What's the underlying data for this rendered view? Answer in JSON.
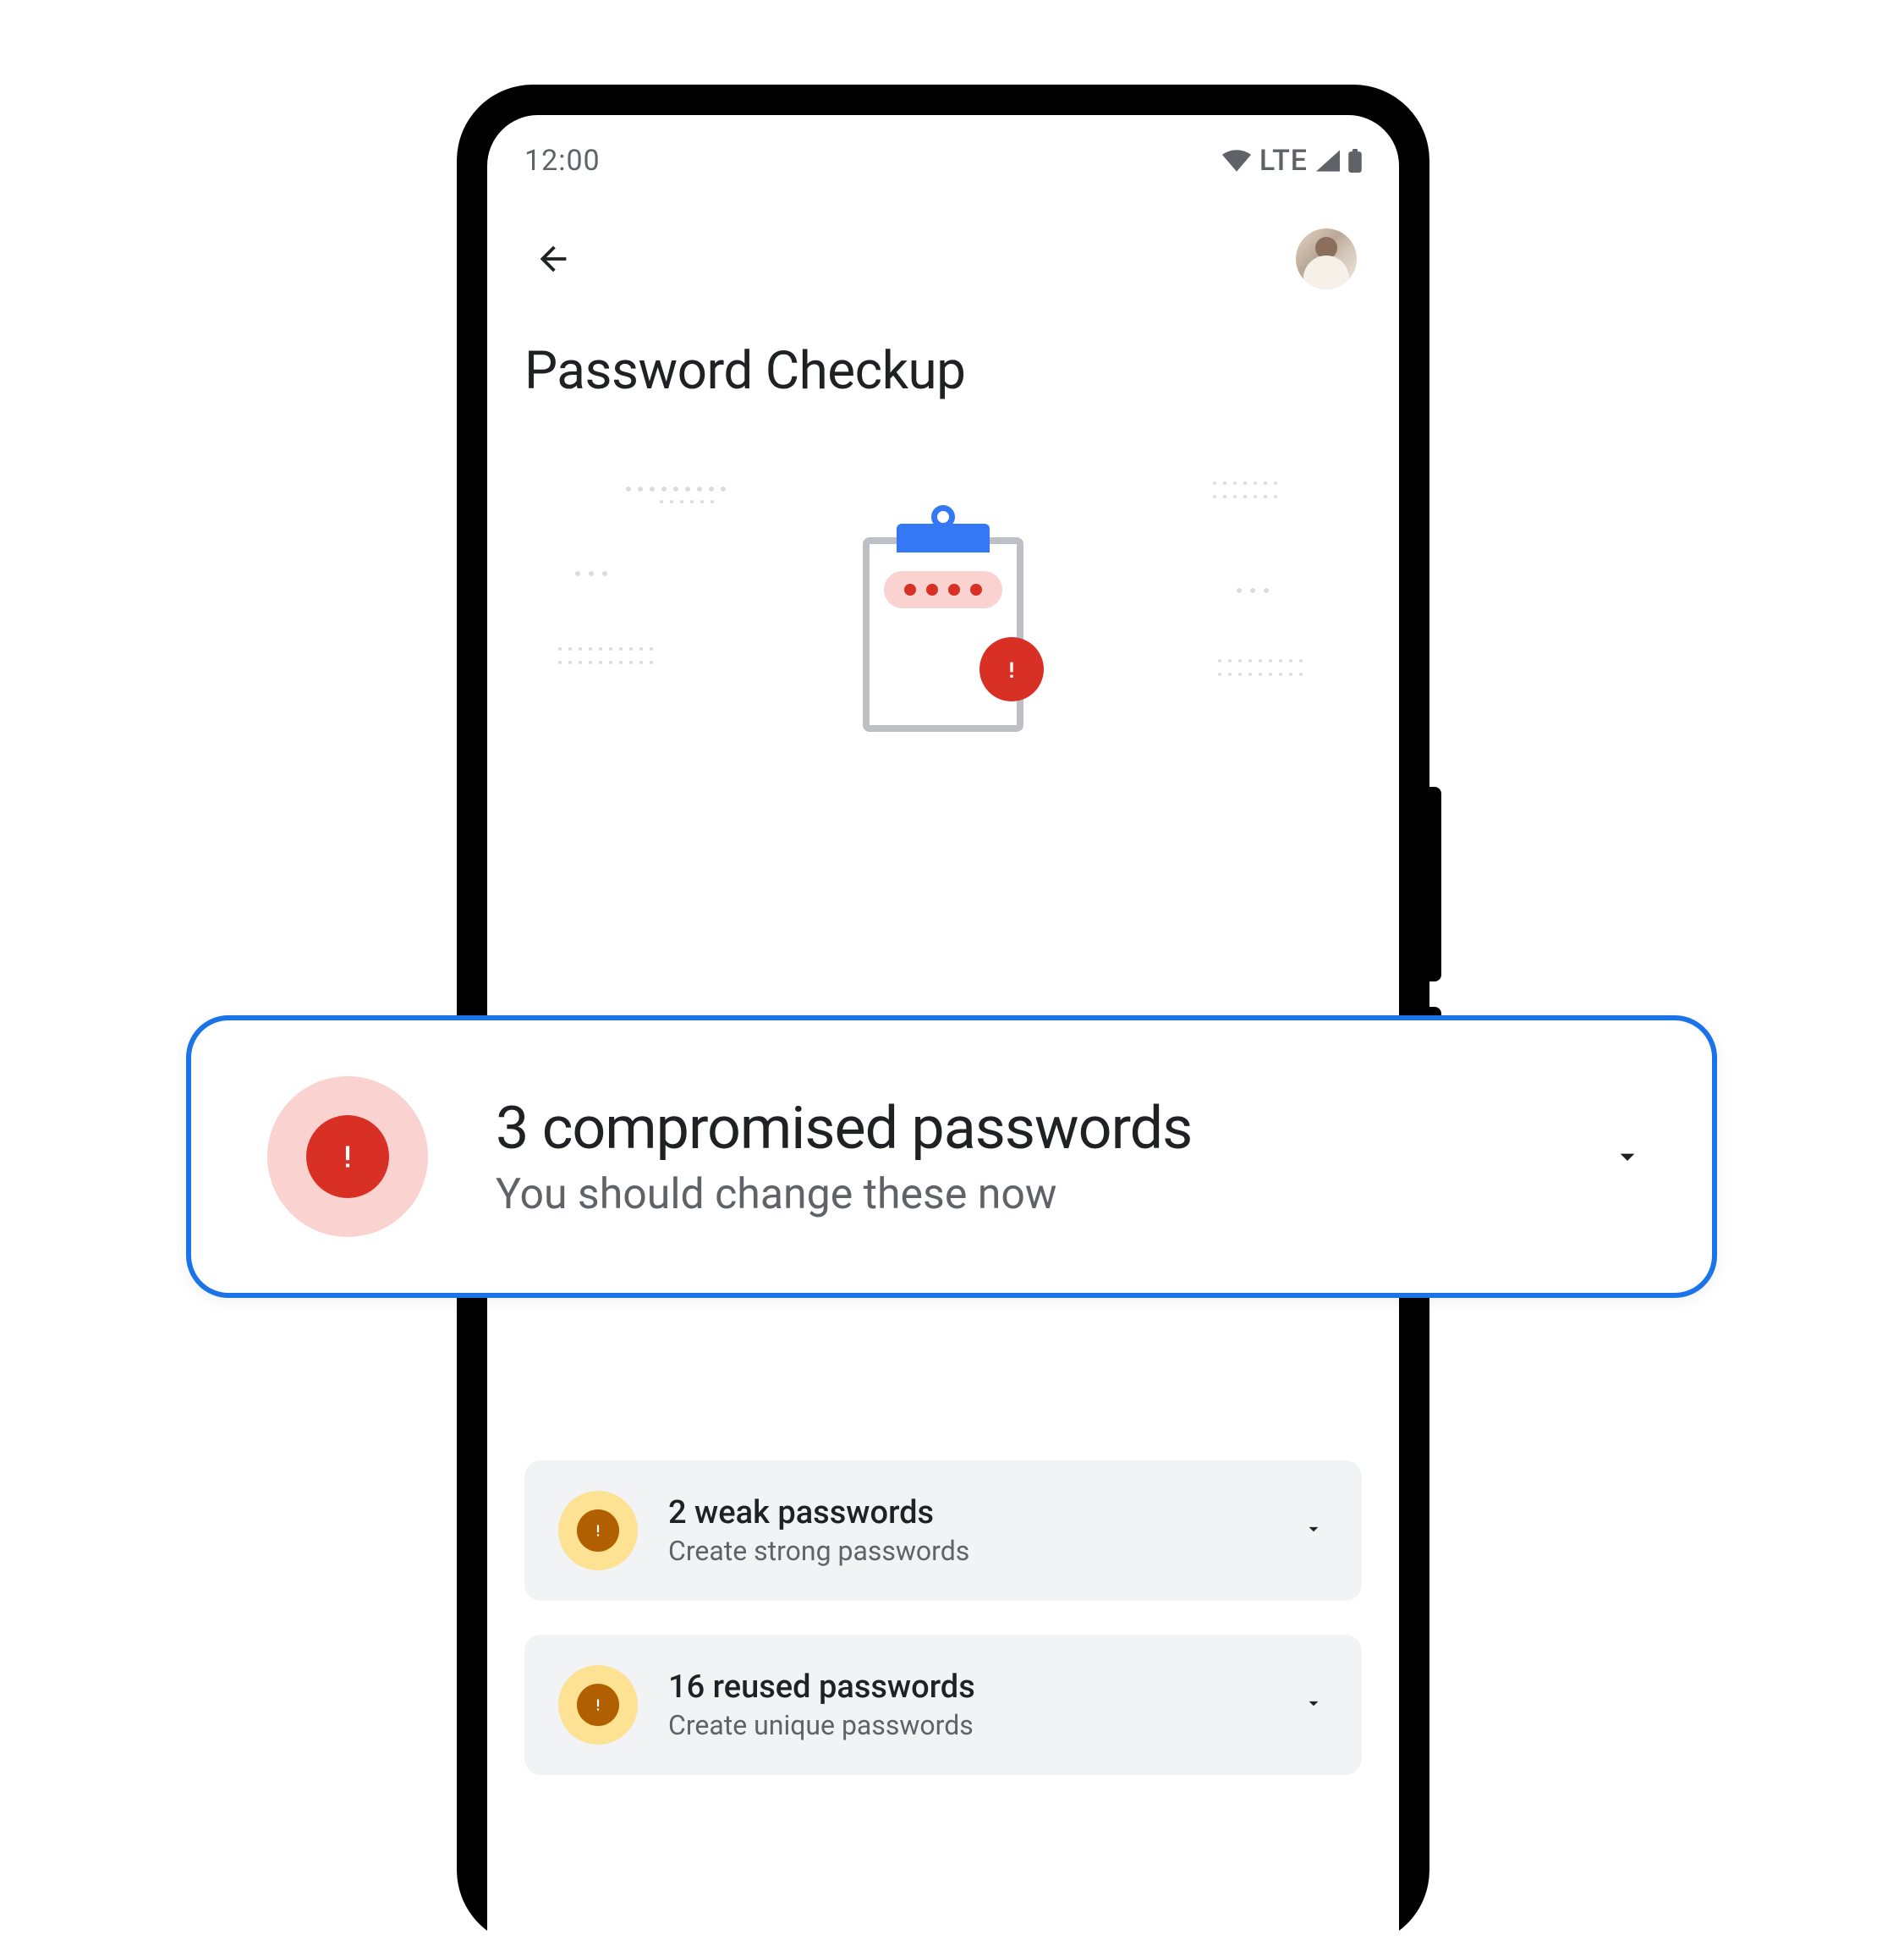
{
  "status_bar": {
    "time": "12:00",
    "network_label": "LTE"
  },
  "page": {
    "title": "Password Checkup"
  },
  "alerts": {
    "compromised": {
      "title": "3 compromised passwords",
      "subtitle": "You should change these now",
      "severity_color": "#d93025"
    },
    "weak": {
      "title": "2 weak passwords",
      "subtitle": "Create strong passwords",
      "severity_color": "#b06000"
    },
    "reused": {
      "title": "16 reused passwords",
      "subtitle": "Create unique passwords",
      "severity_color": "#b06000"
    }
  },
  "colors": {
    "accent_blue": "#1a73e8",
    "text_primary": "#202124",
    "text_secondary": "#5f6368"
  }
}
